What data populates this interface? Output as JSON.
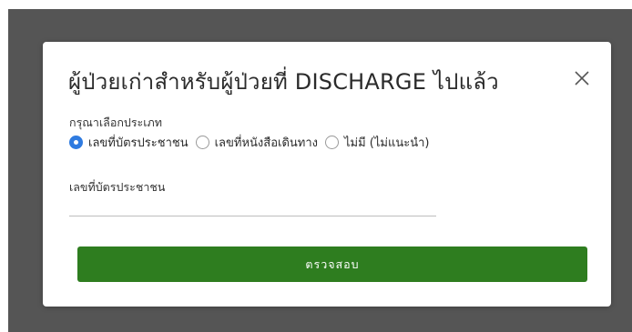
{
  "dialog": {
    "title": "ผู้ป่วยเก่าสำหรับผู้ป่วยที่ DISCHARGE ไปแล้ว",
    "close_icon": "close-icon"
  },
  "type_select": {
    "label": "กรุณาเลือกประเภท",
    "options": [
      {
        "label": "เลขที่บัตรประชาชน",
        "checked": true
      },
      {
        "label": "เลขที่หนังสือเดินทาง",
        "checked": false
      },
      {
        "label": "ไม่มี (ไม่แนะนำ)",
        "checked": false
      }
    ],
    "selected": "เลขที่บัตรประชาชน"
  },
  "id_field": {
    "label": "เลขที่บัตรประชาชน",
    "value": ""
  },
  "submit": {
    "label": "ตรวจสอบ"
  },
  "colors": {
    "accent_radio": "#2f7be0",
    "submit_button": "#2e7d1f",
    "overlay": "#555555"
  }
}
